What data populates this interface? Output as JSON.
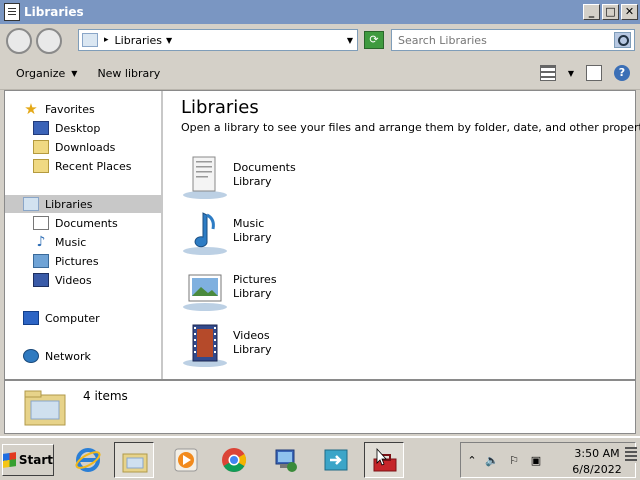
{
  "window": {
    "title": "Libraries",
    "controls": [
      "minimize",
      "maximize",
      "close"
    ]
  },
  "address_bar": {
    "path": "Libraries",
    "separator": "▸",
    "search_placeholder": "Search Libraries"
  },
  "toolbar": {
    "organize_label": "Organize",
    "new_library_label": "New library"
  },
  "nav": {
    "favorites": {
      "label": "Favorites",
      "items": [
        {
          "label": "Desktop",
          "icon": "desktop-icon"
        },
        {
          "label": "Downloads",
          "icon": "downloads-icon"
        },
        {
          "label": "Recent Places",
          "icon": "recent-places-icon"
        }
      ]
    },
    "libraries": {
      "label": "Libraries",
      "items": [
        {
          "label": "Documents",
          "icon": "documents-icon"
        },
        {
          "label": "Music",
          "icon": "music-icon"
        },
        {
          "label": "Pictures",
          "icon": "pictures-icon"
        },
        {
          "label": "Videos",
          "icon": "videos-icon"
        }
      ]
    },
    "computer": {
      "label": "Computer"
    },
    "network": {
      "label": "Network"
    }
  },
  "content": {
    "heading": "Libraries",
    "description": "Open a library to see your files and arrange them by folder, date, and other properties.",
    "libraries": [
      {
        "name": "Documents",
        "type": "Library",
        "icon": "documents-library-icon"
      },
      {
        "name": "Music",
        "type": "Library",
        "icon": "music-library-icon"
      },
      {
        "name": "Pictures",
        "type": "Library",
        "icon": "pictures-library-icon"
      },
      {
        "name": "Videos",
        "type": "Library",
        "icon": "videos-library-icon"
      }
    ]
  },
  "status": {
    "item_count": "4 items"
  },
  "taskbar": {
    "start_label": "Start",
    "apps": [
      "internet-explorer-icon",
      "libraries-icon",
      "media-player-icon",
      "chrome-icon",
      "installer-icon",
      "remote-app-icon",
      "toolbox-icon"
    ],
    "clock_time": "3:50 AM",
    "clock_date": "6/8/2022"
  },
  "colors": {
    "title_bar": "#7a96c2",
    "selection": "#c8c8c8",
    "chrome": "#d4d0c8"
  }
}
